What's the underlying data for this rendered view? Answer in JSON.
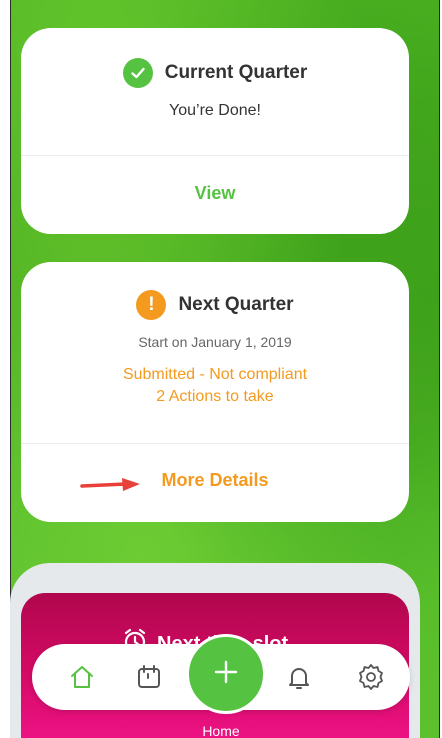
{
  "current_quarter": {
    "title": "Current Quarter",
    "subtitle": "You’re Done!",
    "action_label": "View"
  },
  "next_quarter": {
    "title": "Next Quarter",
    "start_date": "Start on January 1, 2019",
    "status": "Submitted - Not compliant",
    "actions": "2 Actions to take",
    "action_label": "More Details"
  },
  "time_slot": {
    "title": "Next time slot"
  },
  "bottom_nav": {
    "home_label": "Home",
    "items": [
      "home-icon",
      "calendar-icon",
      "add-icon",
      "bell-icon",
      "gear-icon"
    ]
  },
  "colors": {
    "accent_green": "#56c242",
    "accent_orange": "#f39a1f",
    "slot_magenta": "#d10a63"
  }
}
